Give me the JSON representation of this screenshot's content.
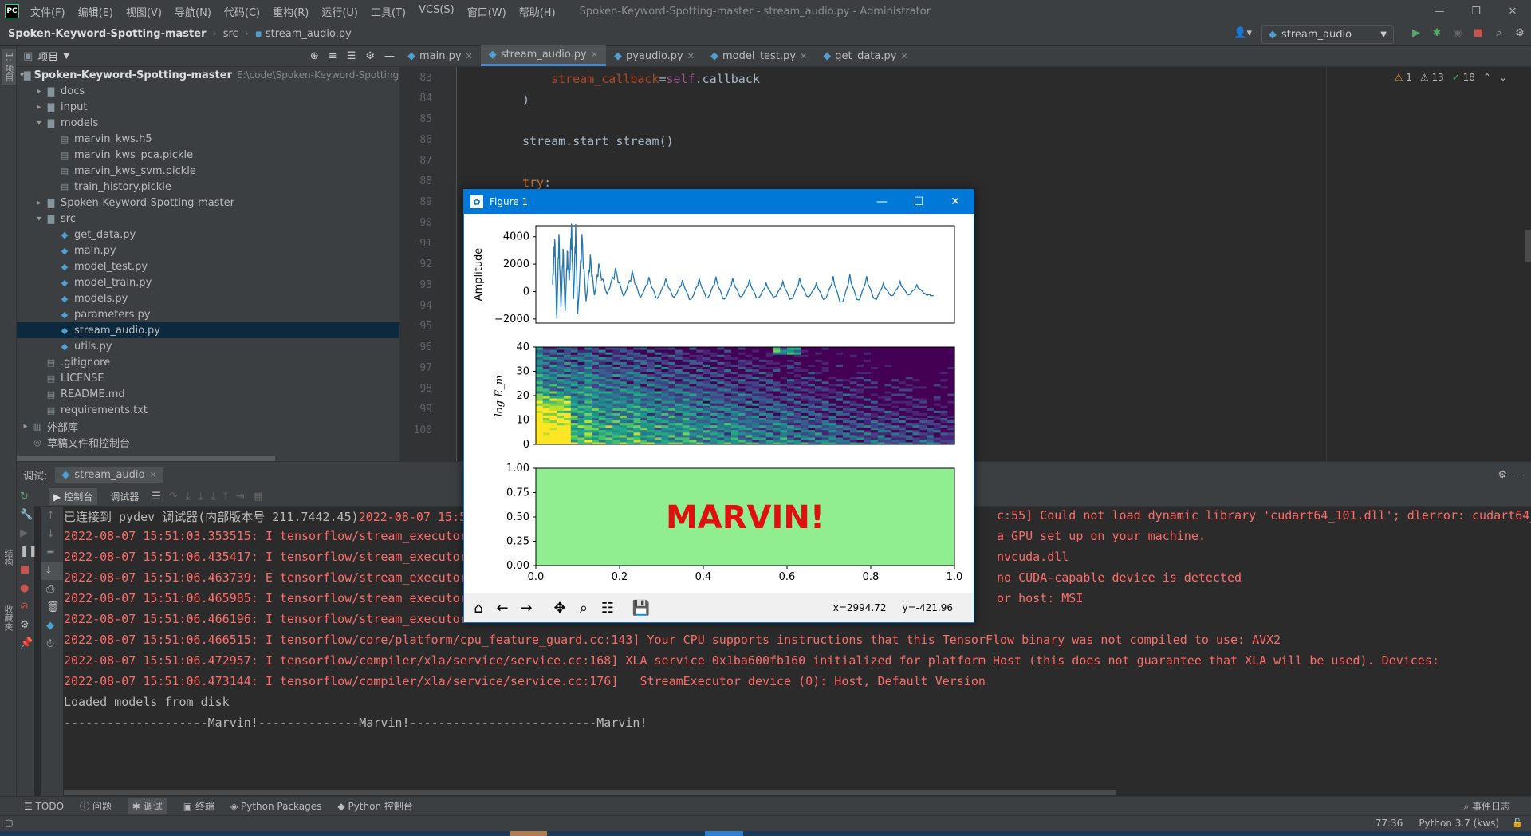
{
  "titlebar": {
    "menu": [
      "文件(F)",
      "编辑(E)",
      "视图(V)",
      "导航(N)",
      "代码(C)",
      "重构(R)",
      "运行(U)",
      "工具(T)",
      "VCS(S)",
      "窗口(W)",
      "帮助(H)"
    ],
    "window_title": "Spoken-Keyword-Spotting-master - stream_audio.py - Administrator"
  },
  "nav": {
    "crumbs": [
      "Spoken-Keyword-Spotting-master",
      "src",
      "stream_audio.py"
    ],
    "run_config": "stream_audio"
  },
  "left_tool": {
    "project_label": "1: 项目",
    "structure_label": "结构",
    "favorites_label": "收藏夹"
  },
  "project": {
    "title": "项目",
    "rows": [
      {
        "label": "Spoken-Keyword-Spotting-master",
        "path": "E:\\code\\Spoken-Keyword-Spotting-ma",
        "indent": 0,
        "arrow": "▾",
        "icon": "folder",
        "bold": true
      },
      {
        "label": "docs",
        "indent": 1,
        "arrow": "▸",
        "icon": "folder"
      },
      {
        "label": "input",
        "indent": 1,
        "arrow": "▸",
        "icon": "folder"
      },
      {
        "label": "models",
        "indent": 1,
        "arrow": "▾",
        "icon": "folder"
      },
      {
        "label": "marvin_kws.h5",
        "indent": 2,
        "arrow": "",
        "icon": "file"
      },
      {
        "label": "marvin_kws_pca.pickle",
        "indent": 2,
        "arrow": "",
        "icon": "file"
      },
      {
        "label": "marvin_kws_svm.pickle",
        "indent": 2,
        "arrow": "",
        "icon": "file"
      },
      {
        "label": "train_history.pickle",
        "indent": 2,
        "arrow": "",
        "icon": "file"
      },
      {
        "label": "Spoken-Keyword-Spotting-master",
        "indent": 1,
        "arrow": "▸",
        "icon": "folder"
      },
      {
        "label": "src",
        "indent": 1,
        "arrow": "▾",
        "icon": "folder"
      },
      {
        "label": "get_data.py",
        "indent": 2,
        "arrow": "",
        "icon": "py"
      },
      {
        "label": "main.py",
        "indent": 2,
        "arrow": "",
        "icon": "py"
      },
      {
        "label": "model_test.py",
        "indent": 2,
        "arrow": "",
        "icon": "py"
      },
      {
        "label": "model_train.py",
        "indent": 2,
        "arrow": "",
        "icon": "py"
      },
      {
        "label": "models.py",
        "indent": 2,
        "arrow": "",
        "icon": "py"
      },
      {
        "label": "parameters.py",
        "indent": 2,
        "arrow": "",
        "icon": "py"
      },
      {
        "label": "stream_audio.py",
        "indent": 2,
        "arrow": "",
        "icon": "py",
        "selected": true
      },
      {
        "label": "utils.py",
        "indent": 2,
        "arrow": "",
        "icon": "py"
      },
      {
        "label": ".gitignore",
        "indent": 1,
        "arrow": "",
        "icon": "file"
      },
      {
        "label": "LICENSE",
        "indent": 1,
        "arrow": "",
        "icon": "file"
      },
      {
        "label": "README.md",
        "indent": 1,
        "arrow": "",
        "icon": "file"
      },
      {
        "label": "requirements.txt",
        "indent": 1,
        "arrow": "",
        "icon": "file"
      },
      {
        "label": "外部库",
        "indent": 0,
        "arrow": "▸",
        "icon": "lib"
      },
      {
        "label": "草稿文件和控制台",
        "indent": 0,
        "arrow": "",
        "icon": "scratch"
      }
    ]
  },
  "editor": {
    "tabs": [
      {
        "label": "main.py",
        "active": false
      },
      {
        "label": "stream_audio.py",
        "active": true
      },
      {
        "label": "pyaudio.py",
        "active": false
      },
      {
        "label": "model_test.py",
        "active": false
      },
      {
        "label": "get_data.py",
        "active": false
      }
    ],
    "line_numbers": [
      "83",
      "84",
      "85",
      "86",
      "87",
      "88",
      "89",
      "90",
      "91",
      "92",
      "93",
      "94",
      "95",
      "96",
      "97",
      "98",
      "99",
      "100"
    ],
    "code": {
      "l83_param": "stream_callback",
      "l83_eq": "=",
      "l83_self": "self",
      "l83_rest": ".callback",
      "l84": ")",
      "l86": "stream.start_stream()",
      "l88_kw": "try",
      "l88_rest": ":"
    },
    "inspections": {
      "warnings": "1",
      "weak": "13",
      "ok": "18"
    }
  },
  "debug": {
    "label": "调试:",
    "session": "stream_audio",
    "subtabs": [
      "控制台",
      "调试器"
    ],
    "console": [
      {
        "text": "已连接到 pydev 调试器(内部版本号 211.7442.45)2022-08-07 15:5",
        "tail": "c:55] Could not load dynamic library 'cudart64_101.dll'; dlerror: cudart64_101",
        "white_prefix": true
      },
      {
        "text": "2022-08-07 15:51:03.353515: I tensorflow/stream_executor",
        "tail": "a GPU set up on your machine."
      },
      {
        "text": "2022-08-07 15:51:06.435417: I tensorflow/stream_executor",
        "tail": "nvcuda.dll"
      },
      {
        "text": "2022-08-07 15:51:06.463739: E tensorflow/stream_executor",
        "tail": "no CUDA-capable device is detected"
      },
      {
        "text": "2022-08-07 15:51:06.465985: I tensorflow/stream_executor",
        "tail": "or host: MSI"
      },
      {
        "text": "2022-08-07 15:51:06.466196: I tensorflow/stream_executor",
        "tail": ""
      },
      {
        "text": "2022-08-07 15:51:06.466515: I tensorflow/core/platform/cpu_feature_guard.cc:143] Your CPU supports instructions that this TensorFlow binary was not compiled to use: AVX2",
        "tail": ""
      },
      {
        "text": "2022-08-07 15:51:06.472957: I tensorflow/compiler/xla/service/service.cc:168] XLA service 0x1ba600fb160 initialized for platform Host (this does not guarantee that XLA will be used). Devices:",
        "tail": ""
      },
      {
        "text": "2022-08-07 15:51:06.473144: I tensorflow/compiler/xla/service/service.cc:176]   StreamExecutor device (0): Host, Default Version",
        "tail": ""
      },
      {
        "text": "Loaded models from disk",
        "tail": "",
        "white": true
      },
      {
        "text": "--------------------Marvin!--------------Marvin!--------------------------Marvin!",
        "tail": "",
        "white": true
      }
    ]
  },
  "bottom_tabs": [
    "TODO",
    "问题",
    "调试",
    "终端",
    "Python Packages",
    "Python 控制台"
  ],
  "status": {
    "position": "77:36",
    "interpreter": "Python 3.7 (kws)",
    "event_log": "事件日志"
  },
  "figure": {
    "title": "Figure 1",
    "coords_x": "x=2994.72",
    "coords_y": "y=-421.96",
    "prediction": "MARVIN!",
    "toolbar": [
      "home-icon",
      "back-icon",
      "forward-icon",
      "pan-icon",
      "zoom-icon",
      "configure-icon",
      "save-icon"
    ]
  },
  "chart_data": [
    {
      "type": "line",
      "ylabel": "Amplitude",
      "ylim": [
        -2300,
        4800
      ],
      "yticks": [
        "4000",
        "2000",
        "0",
        "−2000"
      ],
      "ytick_values": [
        4000,
        2000,
        0,
        -2000
      ],
      "x": [
        0.04,
        0.045,
        0.05,
        0.055,
        0.06,
        0.065,
        0.07,
        0.075,
        0.08,
        0.085,
        0.09,
        0.095,
        0.1,
        0.11,
        0.12,
        0.13,
        0.14,
        0.15,
        0.17,
        0.19,
        0.21,
        0.23,
        0.25,
        0.27,
        0.29,
        0.31,
        0.33,
        0.35,
        0.37,
        0.39,
        0.41,
        0.43,
        0.45,
        0.47,
        0.49,
        0.51,
        0.53,
        0.55,
        0.57,
        0.59,
        0.61,
        0.63,
        0.65,
        0.67,
        0.69,
        0.71,
        0.73,
        0.75,
        0.77,
        0.79,
        0.81,
        0.83,
        0.85,
        0.87,
        0.89,
        0.91,
        0.93,
        0.95
      ],
      "values": [
        500,
        3800,
        -2000,
        4100,
        -1200,
        3000,
        -1500,
        2800,
        800,
        4600,
        -600,
        4500,
        -1800,
        3800,
        -800,
        2400,
        -300,
        1800,
        -200,
        1500,
        -400,
        1300,
        -500,
        900,
        -600,
        800,
        -500,
        700,
        -700,
        800,
        -600,
        900,
        -700,
        800,
        -500,
        700,
        -600,
        500,
        -500,
        600,
        -700,
        800,
        -500,
        500,
        -700,
        900,
        -1000,
        1000,
        -800,
        900,
        -700,
        500,
        -400,
        600,
        -300,
        400,
        -200,
        -300
      ]
    },
    {
      "type": "heatmap",
      "ylabel": "log E_m",
      "ylim": [
        0,
        40
      ],
      "yticks": [
        "40",
        "30",
        "20",
        "10",
        "0"
      ],
      "ytick_values": [
        40,
        30,
        20,
        10,
        0
      ]
    },
    {
      "type": "text-panel",
      "xlim": [
        0,
        1
      ],
      "ylim": [
        0,
        1
      ],
      "xticks": [
        "0.0",
        "0.2",
        "0.4",
        "0.6",
        "0.8",
        "1.0"
      ],
      "xtick_values": [
        0,
        0.2,
        0.4,
        0.6,
        0.8,
        1.0
      ],
      "yticks": [
        "1.00",
        "0.75",
        "0.50",
        "0.25",
        "0.00"
      ],
      "ytick_values": [
        1,
        0.75,
        0.5,
        0.25,
        0
      ],
      "background": "#90ee90",
      "text_color": "#e01010"
    }
  ]
}
